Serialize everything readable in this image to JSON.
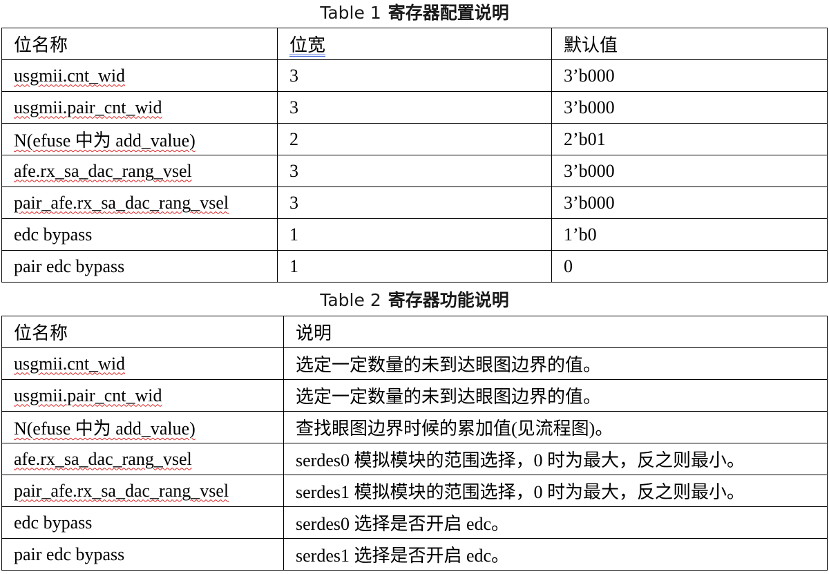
{
  "table1": {
    "caption_label": "Table 1",
    "caption_title": "寄存器配置说明",
    "headers": [
      "位名称",
      "位宽",
      "默认值"
    ],
    "rows": [
      [
        "usgmii.cnt_wid",
        "3",
        "3’b000"
      ],
      [
        "usgmii.pair_cnt_wid",
        "3",
        "3’b000"
      ],
      [
        "N(efuse 中为 add_value)",
        "2",
        "2’b01"
      ],
      [
        "afe.rx_sa_dac_rang_vsel",
        "3",
        "3’b000"
      ],
      [
        "pair_afe.rx_sa_dac_rang_vsel",
        "3",
        "3’b000"
      ],
      [
        "edc bypass",
        "1",
        "1’b0"
      ],
      [
        "pair edc bypass",
        "1",
        "0"
      ]
    ]
  },
  "table2": {
    "caption_label": "Table 2",
    "caption_title": "寄存器功能说明",
    "headers": [
      "位名称",
      "说明"
    ],
    "rows": [
      [
        "usgmii.cnt_wid",
        "选定一定数量的未到达眼图边界的值。"
      ],
      [
        "usgmii.pair_cnt_wid",
        "选定一定数量的未到达眼图边界的值。"
      ],
      [
        "N(efuse 中为 add_value)",
        "查找眼图边界时候的累加值(见流程图)。"
      ],
      [
        "afe.rx_sa_dac_rang_vsel",
        "serdes0 模拟模块的范围选择，0 时为最大，反之则最小。"
      ],
      [
        "pair_afe.rx_sa_dac_rang_vsel",
        "serdes1 模拟模块的范围选择，0 时为最大，反之则最小。"
      ],
      [
        "edc bypass",
        "serdes0 选择是否开启 edc。"
      ],
      [
        "pair edc bypass",
        "serdes1 选择是否开启 edc。"
      ]
    ]
  },
  "colors": {
    "spellcheck_underline": "#d22222",
    "grammar_underline": "#3a5bd6"
  }
}
